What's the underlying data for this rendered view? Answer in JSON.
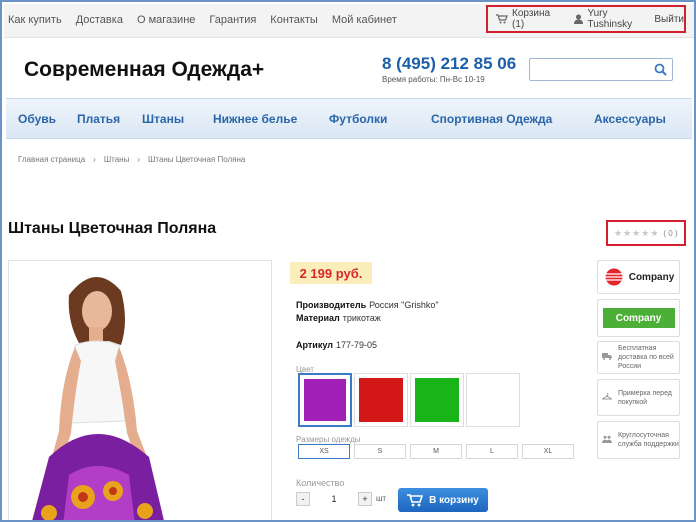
{
  "topnav": {
    "items": [
      "Как купить",
      "Доставка",
      "О магазине",
      "Гарантия",
      "Контакты",
      "Мой кабинет"
    ]
  },
  "account": {
    "cart_label": "Корзина (1)",
    "user_label": "Yury Tushinsky",
    "logout_label": "Выйти"
  },
  "header": {
    "logo": "Современная Одежда+",
    "phone": "8 (495) 212 85 06",
    "hours": "Время работы: Пн-Вс 10-19"
  },
  "search": {
    "placeholder": ""
  },
  "mainmenu": {
    "items": [
      "Обувь",
      "Платья",
      "Штаны",
      "Нижнее белье",
      "Футболки",
      "Спортивная Одежда",
      "Аксессуары"
    ]
  },
  "breadcrumb": {
    "items": [
      "Главная страница",
      "Штаны",
      "Штаны Цветочная Поляна"
    ],
    "separator": "›"
  },
  "product": {
    "title": "Штаны Цветочная Поляна",
    "rating_count": "( 0 )",
    "price": "2 199 руб.",
    "manufacturer_label": "Производитель",
    "manufacturer_value": "Россия \"Grishko\"",
    "material_label": "Материал",
    "material_value": "трикотаж",
    "article_label": "Артикул",
    "article_value": "177-79-05",
    "color_label": "Цвет",
    "colors": [
      "#a020b8",
      "#d41818",
      "#18b418",
      "#ffffff"
    ],
    "size_label": "Размеры одежды",
    "sizes": [
      "XS",
      "S",
      "M",
      "L",
      "XL"
    ],
    "qty_label": "Количество",
    "qty_minus": "-",
    "qty_plus": "+",
    "qty_value": "1",
    "qty_unit": "шт",
    "cart_button": "В корзину"
  },
  "side": {
    "company1": "Company",
    "company2": "Company",
    "features": [
      "Бесплатная доставка по всей России",
      "Примерка перед покупкой",
      "Круглосуточная служба поддержки"
    ]
  },
  "colors": {
    "accent": "#2a66a8",
    "price": "#d8262b",
    "highlight_border": "#d3202e",
    "button": "#1d66be",
    "company_green": "#4caf37",
    "company_red": "#e3262b"
  }
}
